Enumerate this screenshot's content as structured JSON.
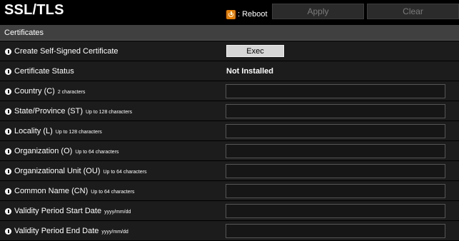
{
  "header": {
    "title": "SSL/TLS",
    "reboot_label": ": Reboot",
    "apply_label": "Apply",
    "clear_label": "Clear"
  },
  "section": {
    "title": "Certificates"
  },
  "rows": [
    {
      "label": "Create Self-Signed Certificate",
      "hint": "",
      "button_label": "Exec"
    },
    {
      "label": "Certificate Status",
      "hint": "",
      "value": "Not Installed"
    },
    {
      "label": "Country (C)",
      "hint": "2 characters",
      "field_value": ""
    },
    {
      "label": "State/Province (ST)",
      "hint": "Up to 128 characters",
      "field_value": ""
    },
    {
      "label": "Locality (L)",
      "hint": "Up to 128 characters",
      "field_value": ""
    },
    {
      "label": "Organization (O)",
      "hint": "Up to 64 characters",
      "field_value": ""
    },
    {
      "label": "Organizational Unit (OU)",
      "hint": "Up to 64 characters",
      "field_value": ""
    },
    {
      "label": "Common Name (CN)",
      "hint": "Up to 64 characters",
      "field_value": ""
    },
    {
      "label": "Validity Period Start Date",
      "hint": "yyyy/mm/dd",
      "field_value": ""
    },
    {
      "label": "Validity Period End Date",
      "hint": "yyyy/mm/dd",
      "field_value": ""
    }
  ],
  "colors": {
    "background": "#000000",
    "row_background": "#1c1c1c",
    "section_header": "#404040",
    "reboot_icon": "#e77d00"
  }
}
